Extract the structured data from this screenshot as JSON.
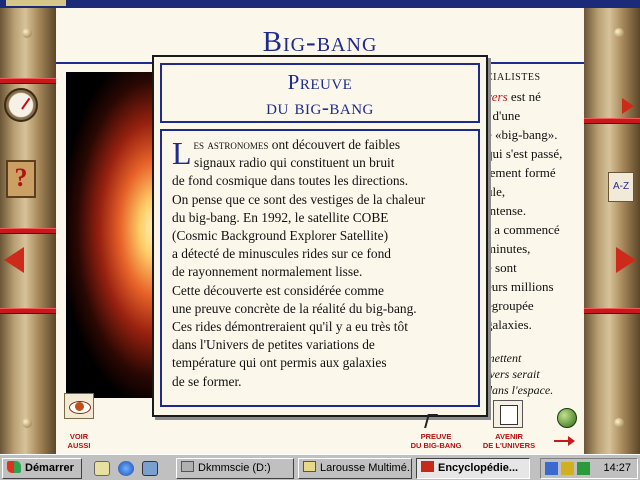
{
  "page": {
    "title": "Big-bang",
    "right_column": [
      {
        "text": "CIALISTES",
        "style": "spec"
      },
      {
        "text": "vers",
        "style": "red",
        "tail": " est né"
      },
      {
        "text": ", d'une",
        "style": ""
      },
      {
        "text": "e «big-bang».",
        "style": ""
      },
      {
        "text": "qui s'est passé,",
        "style": ""
      },
      {
        "text": "lement formé",
        "style": ""
      },
      {
        "text": "ule,",
        "style": ""
      },
      {
        "text": "intense.",
        "style": ""
      },
      {
        "text": "s a commencé",
        "style": ""
      },
      {
        "text": "minutes,",
        "style": ""
      },
      {
        "text": "e sont",
        "style": ""
      },
      {
        "text": "eurs millions",
        "style": ""
      },
      {
        "text": "egroupée",
        "style": ""
      },
      {
        "text": "galaxies.",
        "style": ""
      }
    ],
    "right_column_italic": [
      "mettent",
      "ivers serait",
      "dans l'espace."
    ]
  },
  "popup": {
    "title_line1": "Preuve",
    "title_line2": "du big-bang",
    "dropcap": "L",
    "first_smallcaps": "es astronomes",
    "lines": [
      " ont découvert de faibles",
      "signaux radio qui constituent un bruit",
      "de fond cosmique dans toutes les directions.",
      "On pense que ce sont des vestiges de la chaleur",
      "du big-bang. En 1992, le satellite COBE",
      "(Cosmic Background Explorer Satellite)",
      "a détecté de minuscules rides sur ce fond",
      "de rayonnement normalement lisse.",
      "Cette découverte est considérée comme",
      "une preuve concrète de la réalité du big-bang.",
      "Ces rides démontreraient qu'il y a eu très tôt",
      "dans l'Univers de petites variations de",
      "température qui ont permis aux galaxies",
      "de se former."
    ]
  },
  "nav": {
    "voir_aussi_1": "VOIR",
    "voir_aussi_2": "AUSSI",
    "preuve_1": "PREUVE",
    "preuve_2": "DU BIG-BANG",
    "avenir_1": "AVENIR",
    "avenir_2": "DE L'UNIVERS"
  },
  "taskbar": {
    "start": "Démarrer",
    "tasks": [
      "Dkmmscie (D:)",
      "Larousse Multimé...",
      "Encyclopédie..."
    ],
    "clock": "14:27"
  },
  "colors": {
    "title_blue": "#1e2a8c",
    "accent_red": "#c41a1a"
  }
}
